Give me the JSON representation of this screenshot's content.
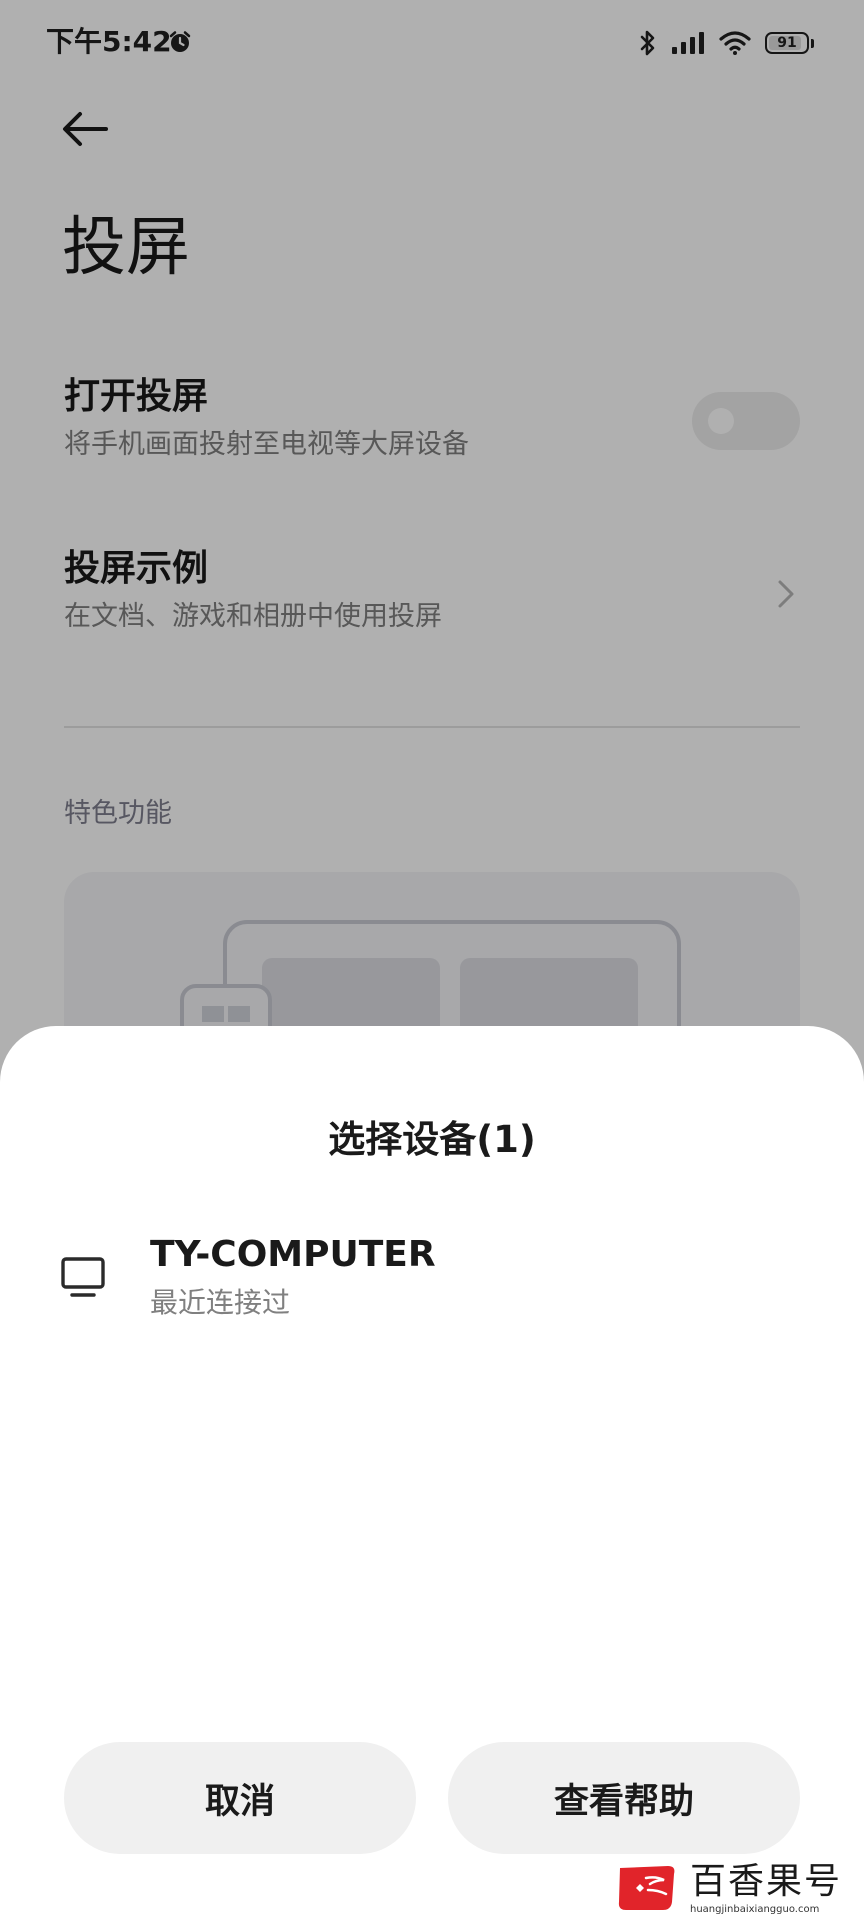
{
  "status_bar": {
    "time": "下午5:42",
    "battery": "91",
    "battery_level": 0.91
  },
  "page": {
    "title": "投屏",
    "cast_toggle": {
      "title": "打开投屏",
      "subtitle": "将手机画面投射至电视等大屏设备",
      "enabled": false
    },
    "cast_examples": {
      "title": "投屏示例",
      "subtitle": "在文档、游戏和相册中使用投屏"
    },
    "section_label": "特色功能"
  },
  "sheet": {
    "title": "选择设备(1)",
    "devices": [
      {
        "name": "TY-COMPUTER",
        "status": "最近连接过",
        "icon": "monitor-icon"
      }
    ],
    "cancel_label": "取消",
    "help_label": "查看帮助"
  },
  "watermark": {
    "text": "百香果号",
    "url": "huangjinbaixiangguo.com"
  },
  "colors": {
    "scrim": "#000000",
    "sheet_bg": "#ffffff",
    "button_bg": "#f0f0f0",
    "text_primary": "#1a1a1a",
    "text_secondary": "#808080",
    "section_label": "#7f7f8e",
    "watermark_red": "#e1242a"
  }
}
